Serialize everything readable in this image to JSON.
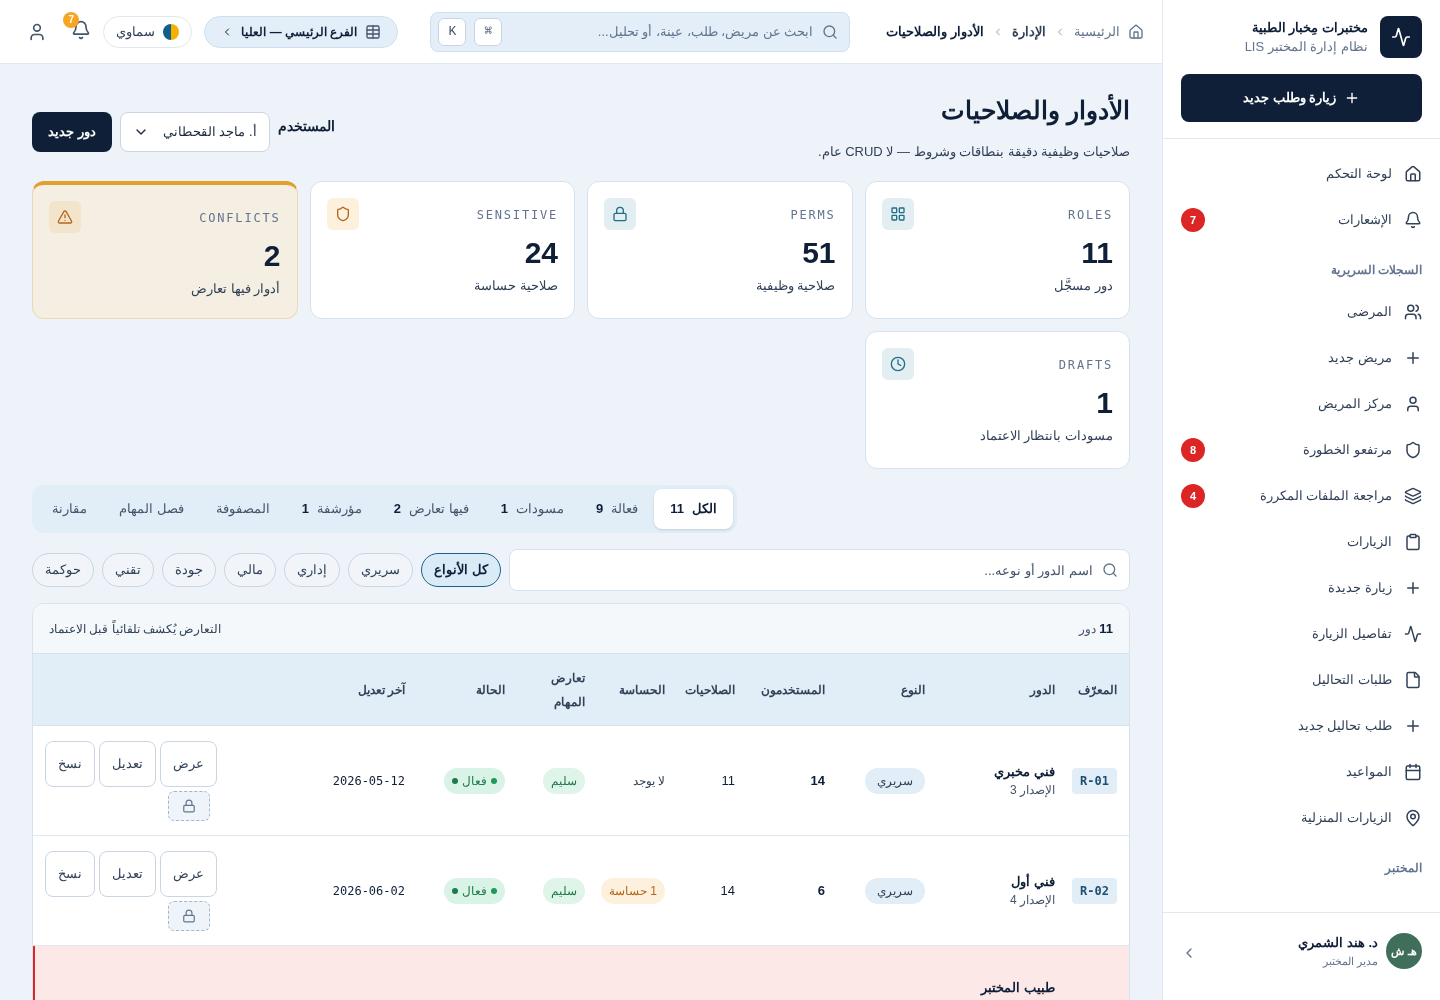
{
  "sidebar": {
    "brand": {
      "title": "مختبرات مِخبار الطبية",
      "subtitle": "نظام إدارة المختبر LIS"
    },
    "primary_button": "زيارة وطلب جديد",
    "items": [
      {
        "kind": "item",
        "label": "لوحة التحكم"
      },
      {
        "kind": "item",
        "label": "الإشعارات",
        "badge": "7"
      },
      {
        "kind": "section",
        "label": "السجلات السريرية"
      },
      {
        "kind": "item",
        "label": "المرضى"
      },
      {
        "kind": "item",
        "label": "مريض جديد"
      },
      {
        "kind": "item",
        "label": "مركز المريض"
      },
      {
        "kind": "item",
        "label": "مرتفعو الخطورة",
        "badge": "8"
      },
      {
        "kind": "item",
        "label": "مراجعة الملفات المكررة",
        "badge": "4"
      },
      {
        "kind": "item",
        "label": "الزيارات"
      },
      {
        "kind": "item",
        "label": "زيارة جديدة"
      },
      {
        "kind": "item",
        "label": "تفاصيل الزيارة"
      },
      {
        "kind": "item",
        "label": "طلبات التحاليل"
      },
      {
        "kind": "item",
        "label": "طلب تحاليل جديد"
      },
      {
        "kind": "item",
        "label": "المواعيد"
      },
      {
        "kind": "item",
        "label": "الزيارات المنزلية"
      },
      {
        "kind": "section",
        "label": "المختبر"
      }
    ],
    "user": {
      "name": "د. هند الشمري",
      "role": "مدير المختبر",
      "initials": "هـ ش"
    }
  },
  "header": {
    "breadcrumb": [
      {
        "label": "الرئيسية",
        "current": false
      },
      {
        "label": "الإدارة",
        "current": false
      },
      {
        "label": "الأدوار والصلاحيات",
        "current": true
      }
    ],
    "search": {
      "placeholder": "ابحث عن مريض، طلب، عينة، أو تحليل...",
      "keys": [
        "⌘",
        "K"
      ]
    },
    "branch": "الفرع الرئيسي — العليا",
    "theme": "سماوي",
    "notifications": "7"
  },
  "page": {
    "title": "الأدوار والصلاحيات",
    "subtitle": "صلاحيات وظيفية دقيقة بنطاقات وشروط — لا CRUD عام.",
    "user_label": "المستخدم",
    "user_select": "أ. ماجد القحطاني",
    "new_button": "دور جديد"
  },
  "stats": [
    {
      "kind": "neutral",
      "label": "ROLES",
      "value": "11",
      "caption": "دور مسجَّل"
    },
    {
      "kind": "neutral",
      "label": "PERMS",
      "value": "51",
      "caption": "صلاحية وظيفية"
    },
    {
      "kind": "warning",
      "label": "SENSITIVE",
      "value": "24",
      "caption": "صلاحية حساسة"
    },
    {
      "kind": "alert",
      "label": "CONFLICTS",
      "value": "2",
      "caption": "أدوار فيها تعارض"
    },
    {
      "kind": "neutral",
      "label": "DRAFTS",
      "value": "1",
      "caption": "مسودات بانتظار الاعتماد"
    }
  ],
  "tabs": [
    {
      "label": "الكل",
      "count": "11",
      "selected": true
    },
    {
      "label": "فعالة",
      "count": "9",
      "selected": false
    },
    {
      "label": "مسودات",
      "count": "1",
      "selected": false
    },
    {
      "label": "فيها تعارض",
      "count": "2",
      "selected": false
    },
    {
      "label": "مؤرشفة",
      "count": "1",
      "selected": false
    },
    {
      "label": "المصفوفة",
      "selected": false
    },
    {
      "label": "فصل المهام",
      "selected": false
    },
    {
      "label": "مقارنة",
      "selected": false
    }
  ],
  "filter": {
    "placeholder": "اسم الدور أو نوعه...",
    "chips": [
      {
        "label": "كل الأنواع",
        "selected": true
      },
      {
        "label": "سريري",
        "selected": false
      },
      {
        "label": "إداري",
        "selected": false
      },
      {
        "label": "مالي",
        "selected": false
      },
      {
        "label": "جودة",
        "selected": false
      },
      {
        "label": "تقني",
        "selected": false
      },
      {
        "label": "حوكمة",
        "selected": false
      }
    ]
  },
  "table": {
    "count": "11",
    "count_unit": "دور",
    "note": "التعارض يُكشف تلقائياً قبل الاعتماد",
    "columns": [
      "المعرّف",
      "الدور",
      "النوع",
      "المستخدمون",
      "الصلاحيات",
      "الحساسة",
      "تعارض المهام",
      "الحالة",
      "آخر تعديل"
    ],
    "rows": [
      {
        "conflict": false,
        "id": "R-01",
        "name": "فني مخبري",
        "version": "الإصدار 3",
        "type": "سريري",
        "users": "14",
        "perms": "11",
        "sensitive": {
          "kind": "none",
          "text": "لا يوجد"
        },
        "sod": "سليم",
        "status": "فعال",
        "date": "2026-05-12",
        "actions": [
          "عرض",
          "تعديل",
          "نسخ"
        ]
      },
      {
        "conflict": false,
        "id": "R-02",
        "name": "فني أول",
        "version": "الإصدار 4",
        "type": "سريري",
        "users": "6",
        "perms": "14",
        "sensitive": {
          "kind": "count",
          "text": "1 حساسة"
        },
        "sod": "سليم",
        "status": "فعال",
        "date": "2026-06-02",
        "actions": [
          "عرض",
          "تعديل",
          "نسخ"
        ]
      },
      {
        "conflict": true,
        "name": "طبيب المختبر"
      }
    ]
  }
}
